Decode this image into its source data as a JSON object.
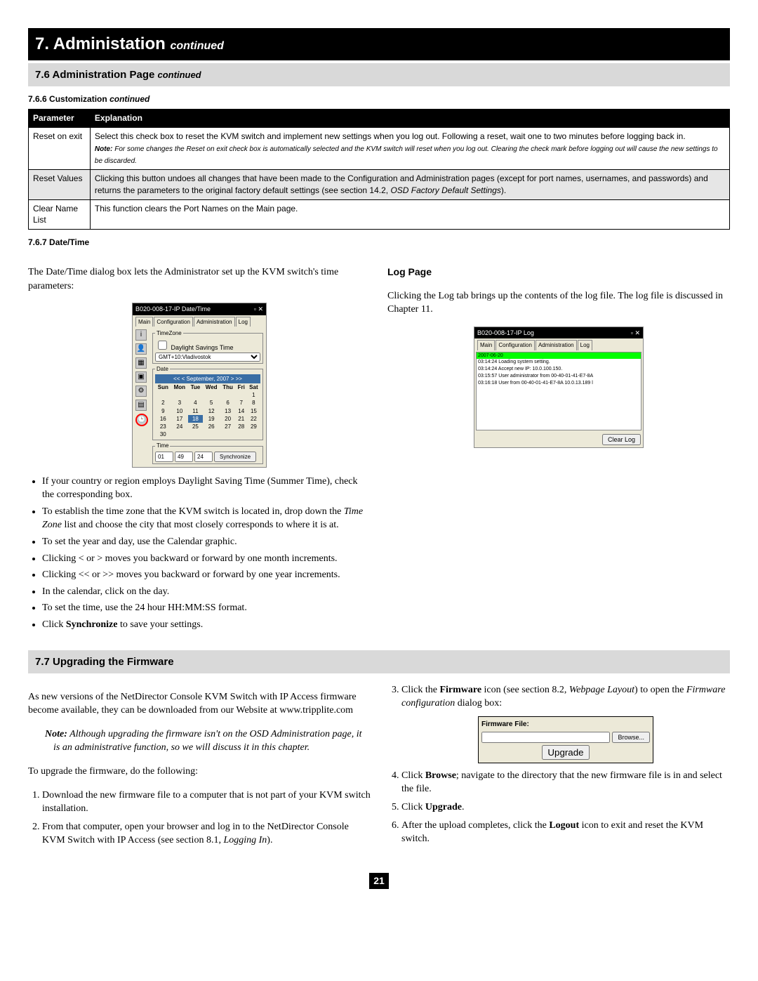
{
  "chapter": {
    "num": "7.",
    "title": "Administation",
    "cont": "continued"
  },
  "section76": {
    "num": "7.6",
    "title": "Administration Page",
    "cont": "continued"
  },
  "subsection766": {
    "num": "7.6.6",
    "title": "Customization",
    "cont": "continued"
  },
  "table": {
    "head": {
      "param": "Parameter",
      "expl": "Explanation"
    },
    "rows": [
      {
        "param": "Reset on exit",
        "expl": "Select this check box to reset the KVM switch and implement new settings when you log out.  Following a reset, wait one to two minutes before logging back in.",
        "note_label": "Note:",
        "note": "For some changes the Reset on exit check box is automatically selected and the KVM switch will reset when you log out. Clearing the check mark before logging out  will cause the new settings to be discarded."
      },
      {
        "param": "Reset Values",
        "expl_pre": "Clicking this button undoes all changes that have been made to the Configuration and Administration pages (except for port names, usernames, and passwords) and returns the parameters to the original factory default settings (see section 14.2, ",
        "expl_ital": "OSD Factory Default Settings",
        "expl_post": ")."
      },
      {
        "param": "Clear Name List",
        "expl": "This function clears the Port Names on the Main page."
      }
    ]
  },
  "subsection767": {
    "num": "7.6.7",
    "title": "Date/Time"
  },
  "datetime_intro": "The Date/Time dialog box lets the Administrator set up the KVM switch's time parameters:",
  "dt_window": {
    "title": "B020-008-17-IP Date/Time",
    "tabs": [
      "Main",
      "Configuration",
      "Administration",
      "Log"
    ],
    "tz_legend": "TimeZone",
    "dst_label": "Daylight Savings Time",
    "tz_value": "GMT+10:Vladivostok",
    "date_legend": "Date",
    "month": "September, 2007",
    "nav": {
      "yprev": "<<",
      "mprev": "<",
      "mnext": ">",
      "ynext": ">>"
    },
    "dow": [
      "Sun",
      "Mon",
      "Tue",
      "Wed",
      "Thu",
      "Fri",
      "Sat"
    ],
    "grid": [
      [
        "",
        "",
        "",
        "",
        "",
        "",
        "1"
      ],
      [
        "2",
        "3",
        "4",
        "5",
        "6",
        "7",
        "8"
      ],
      [
        "9",
        "10",
        "11",
        "12",
        "13",
        "14",
        "15"
      ],
      [
        "16",
        "17",
        "18",
        "19",
        "20",
        "21",
        "22"
      ],
      [
        "23",
        "24",
        "25",
        "26",
        "27",
        "28",
        "29"
      ],
      [
        "30",
        "",
        "",
        "",
        "",
        "",
        ""
      ]
    ],
    "selected_day": "18",
    "time_legend": "Time",
    "time": {
      "hh": "01",
      "mm": "49",
      "ss": "24"
    },
    "sync": "Synchronize"
  },
  "dt_bullets": [
    "If your country or region employs Daylight Saving Time (Summer Time), check the corresponding box.",
    "To establish the time zone that the KVM switch is located in, drop down the <i>Time Zone</i> list and choose the city that most closely corresponds to where it is at.",
    "To set the year and day, use the Calendar graphic.",
    "Clicking < or > moves you backward or forward by one month increments.",
    "Clicking << or >> moves you backward or forward by one year increments.",
    "In the calendar, click on the day.",
    "To set the time, use the 24 hour HH:MM:SS format.",
    "Click <b>Synchronize</b> to save your settings."
  ],
  "log_heading": "Log Page",
  "log_intro": "Clicking the Log tab brings up the contents of the log file. The log file is discussed in Chapter 11.",
  "log_window": {
    "title": "B020-008-17-IP Log",
    "tabs": [
      "Main",
      "Configuration",
      "Administration",
      "Log"
    ],
    "entries": [
      {
        "cls": "green",
        "text": "2007-06-20"
      },
      {
        "cls": "",
        "text": "03:14:24 Loading system setting."
      },
      {
        "cls": "",
        "text": "03:14:24 Accept new IP: 10.0.100.150."
      },
      {
        "cls": "",
        "text": "03:15:57 User administrator from 00-40-01-41-E7-8A"
      },
      {
        "cls": "",
        "text": "03:16:18 User from 00-40-01-41-E7-8A 10.0.13.189 l"
      }
    ],
    "clear": "Clear Log"
  },
  "section77": {
    "num": "7.7",
    "title": "Upgrading the Firmware"
  },
  "fw_left": {
    "intro": "As new versions of the NetDirector Console KVM Switch with IP Access firmware become available, they can be downloaded from our Website at www.tripplite.com",
    "note_label": "Note:",
    "note": "Although upgrading the firmware isn't on the OSD Administration page, it is an administrative function, so we will discuss it in this chapter.",
    "steps_intro": "To upgrade the firmware, do the following:",
    "step1": "Download the new firmware file to a computer that is not part of your KVM switch installation.",
    "step2_pre": "From that computer, open your browser and log in to the NetDirector Console KVM Switch with IP Access (see section 8.1, ",
    "step2_ital": "Logging In",
    "step2_post": ")."
  },
  "fw_right": {
    "step3_pre": "Click the ",
    "step3_b": "Firmware",
    "step3_mid": " icon (see section 8.2, ",
    "step3_ital": "Webpage Layout",
    "step3_mid2": ") to open the ",
    "step3_ital2": "Firmware configuration",
    "step3_post": " dialog box:",
    "fw_box": {
      "label": "Firmware File:",
      "browse": "Browse...",
      "upgrade": "Upgrade"
    },
    "step4_pre": "Click ",
    "step4_b": "Browse",
    "step4_post": "; navigate to the directory that the new firmware file is in and select the file.",
    "step5_pre": "Click ",
    "step5_b": "Upgrade",
    "step5_post": ".",
    "step6_pre": "After the upload completes, click the ",
    "step6_b": "Logout",
    "step6_post": " icon to exit and reset the KVM switch."
  },
  "page_number": "21"
}
